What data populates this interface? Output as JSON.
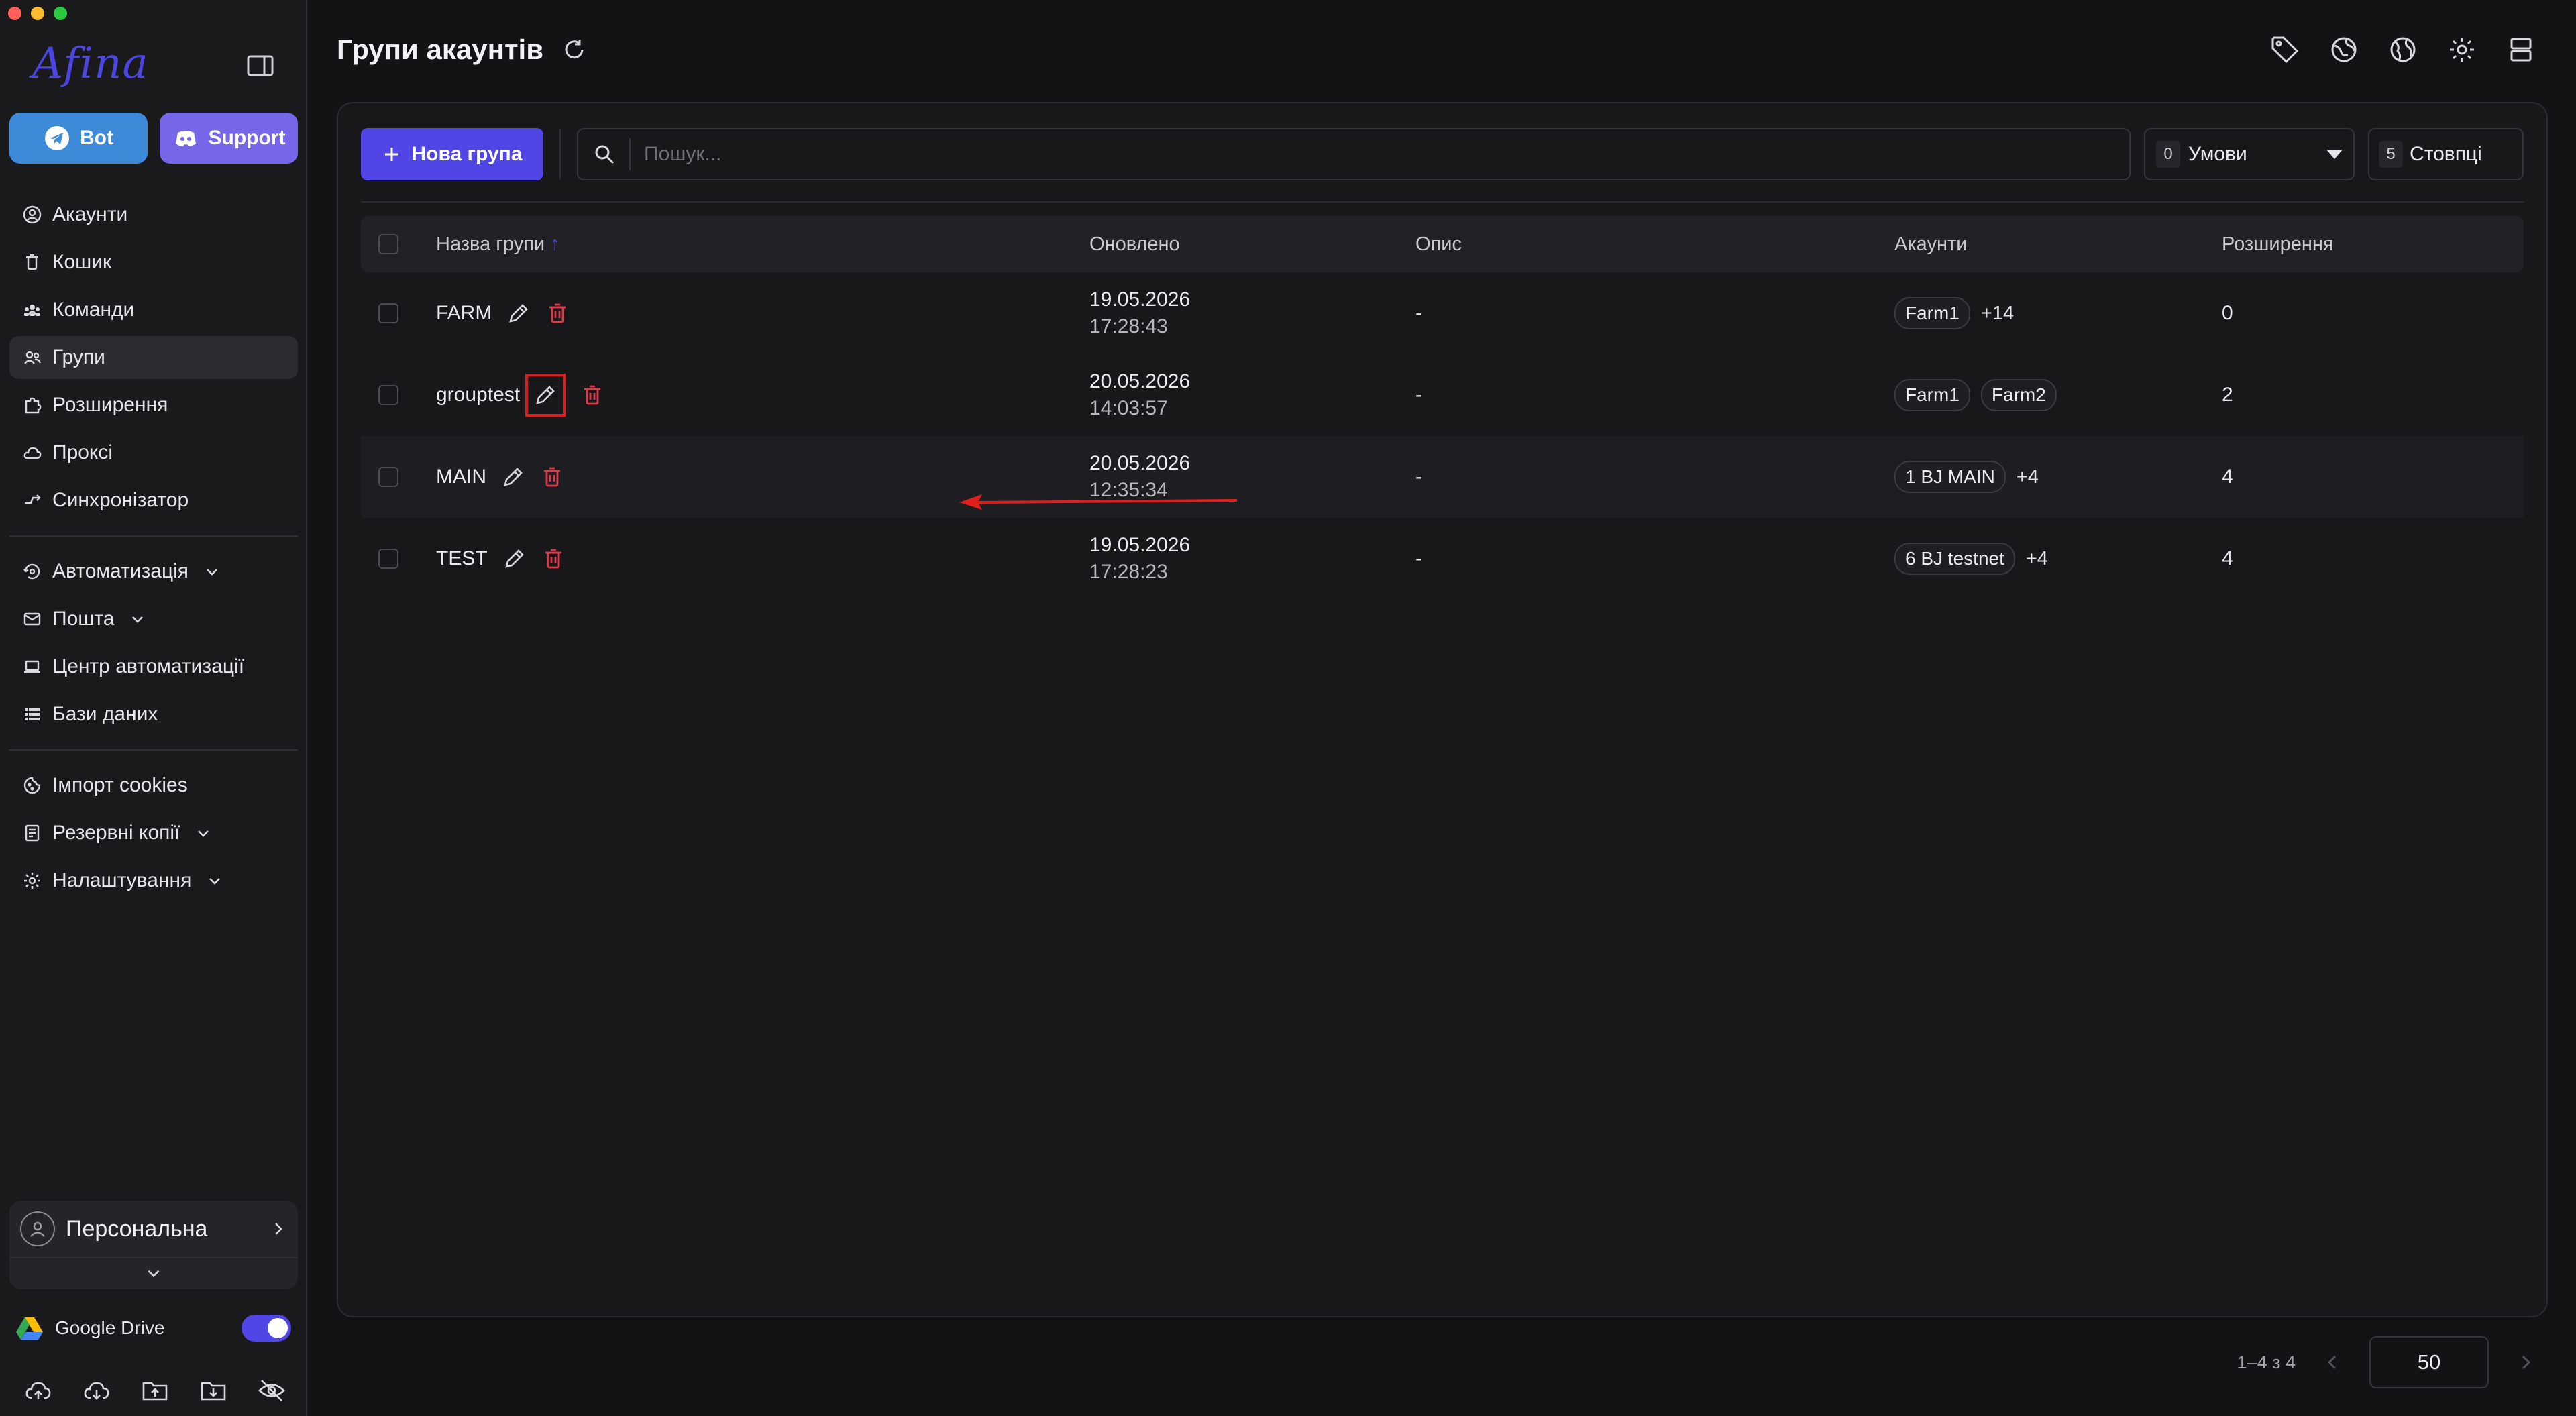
{
  "app": {
    "logo_text": "Afina",
    "accent": "#4f46e5",
    "danger": "#e0394a"
  },
  "sidebar": {
    "bot_label": "Bot",
    "support_label": "Support",
    "nav_primary": [
      {
        "label": "Акаунти",
        "icon": "user-circle-icon"
      },
      {
        "label": "Кошик",
        "icon": "trash-icon"
      },
      {
        "label": "Команди",
        "icon": "team-icon"
      },
      {
        "label": "Групи",
        "icon": "users-icon",
        "active": true
      },
      {
        "label": "Розширення",
        "icon": "puzzle-icon"
      },
      {
        "label": "Проксі",
        "icon": "cloud-icon"
      },
      {
        "label": "Синхронізатор",
        "icon": "sync-icon"
      }
    ],
    "nav_secondary": [
      {
        "label": "Автоматизація",
        "icon": "automation-icon"
      },
      {
        "label": "Пошта",
        "icon": "mail-icon"
      },
      {
        "label": "Центр автоматизації",
        "icon": "laptop-icon"
      },
      {
        "label": "Бази даних",
        "icon": "list-icon"
      }
    ],
    "nav_tertiary": [
      {
        "label": "Імпорт cookies",
        "icon": "cookie-icon"
      },
      {
        "label": "Резервні копії",
        "icon": "backup-icon"
      },
      {
        "label": "Налаштування",
        "icon": "gear-icon"
      }
    ],
    "profile_name": "Персональна",
    "gdrive_label": "Google Drive",
    "gdrive_enabled": true
  },
  "header": {
    "title": "Групи акаунтів"
  },
  "toolbar": {
    "new_group_label": "Нова група",
    "search_placeholder": "Пошук...",
    "conditions_count": "0",
    "conditions_label": "Умови",
    "columns_count": "5",
    "columns_label": "Стовпці"
  },
  "table": {
    "headers": {
      "name": "Назва групи",
      "updated": "Оновлено",
      "description": "Опис",
      "accounts": "Акаунти",
      "extensions": "Розширення"
    },
    "rows": [
      {
        "name": "FARM",
        "date": "19.05.2026",
        "time": "17:28:43",
        "description": "-",
        "tags": [
          "Farm1"
        ],
        "more": "+14",
        "extensions": "0"
      },
      {
        "name": "grouptest",
        "date": "20.05.2026",
        "time": "14:03:57",
        "description": "-",
        "tags": [
          "Farm1",
          "Farm2"
        ],
        "more": "",
        "extensions": "2"
      },
      {
        "name": "MAIN",
        "date": "20.05.2026",
        "time": "12:35:34",
        "description": "-",
        "tags": [
          "1 BJ MAIN"
        ],
        "more": "+4",
        "extensions": "4"
      },
      {
        "name": "TEST",
        "date": "19.05.2026",
        "time": "17:28:23",
        "description": "-",
        "tags": [
          "6 BJ testnet"
        ],
        "more": "+4",
        "extensions": "4"
      }
    ]
  },
  "pagination": {
    "range": "1–4 з 4",
    "per_page": "50"
  }
}
